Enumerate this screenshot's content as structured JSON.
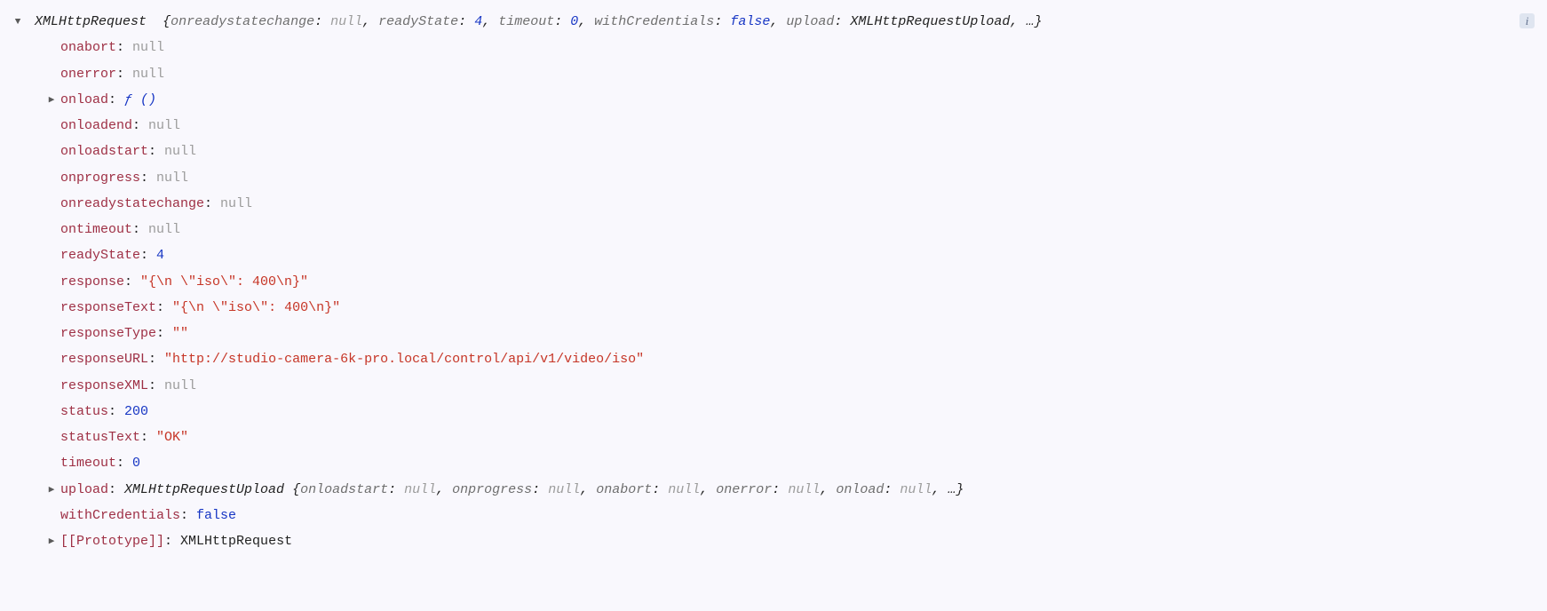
{
  "header": {
    "objectName": "XMLHttpRequest",
    "previewPairs": [
      {
        "key": "onreadystatechange",
        "value": "null",
        "vclass": "prev-null"
      },
      {
        "key": "readyState",
        "value": "4",
        "vclass": "prev-num"
      },
      {
        "key": "timeout",
        "value": "0",
        "vclass": "prev-num"
      },
      {
        "key": "withCredentials",
        "value": "false",
        "vclass": "prev-bool"
      },
      {
        "key": "upload",
        "value": "XMLHttpRequestUpload",
        "vclass": "prev-obj"
      }
    ],
    "ellipsis": "…",
    "infoBadge": "i"
  },
  "props": {
    "onabort": {
      "key": "onabort",
      "value": "null",
      "vclass": "val-null"
    },
    "onerror": {
      "key": "onerror",
      "value": "null",
      "vclass": "val-null"
    },
    "onload": {
      "key": "onload",
      "value": "ƒ ()",
      "vclass": "val-func"
    },
    "onloadend": {
      "key": "onloadend",
      "value": "null",
      "vclass": "val-null"
    },
    "onloadstart": {
      "key": "onloadstart",
      "value": "null",
      "vclass": "val-null"
    },
    "onprogress": {
      "key": "onprogress",
      "value": "null",
      "vclass": "val-null"
    },
    "onreadystatechange": {
      "key": "onreadystatechange",
      "value": "null",
      "vclass": "val-null"
    },
    "ontimeout": {
      "key": "ontimeout",
      "value": "null",
      "vclass": "val-null"
    },
    "readyState": {
      "key": "readyState",
      "value": "4",
      "vclass": "val-num"
    },
    "response": {
      "key": "response",
      "value": "\"{\\n    \\\"iso\\\": 400\\n}\"",
      "vclass": "val-str"
    },
    "responseText": {
      "key": "responseText",
      "value": "\"{\\n    \\\"iso\\\": 400\\n}\"",
      "vclass": "val-str"
    },
    "responseType": {
      "key": "responseType",
      "value": "\"\"",
      "vclass": "val-str"
    },
    "responseURL": {
      "key": "responseURL",
      "value": "\"http://studio-camera-6k-pro.local/control/api/v1/video/iso\"",
      "vclass": "val-str"
    },
    "responseXML": {
      "key": "responseXML",
      "value": "null",
      "vclass": "val-null"
    },
    "status": {
      "key": "status",
      "value": "200",
      "vclass": "val-num"
    },
    "statusText": {
      "key": "statusText",
      "value": "\"OK\"",
      "vclass": "val-str"
    },
    "timeout": {
      "key": "timeout",
      "value": "0",
      "vclass": "val-num"
    },
    "withCredentials": {
      "key": "withCredentials",
      "value": "false",
      "vclass": "val-bool"
    },
    "prototype": {
      "key": "[[Prototype]]",
      "value": "XMLHttpRequest",
      "vclass": "val-obj"
    }
  },
  "upload": {
    "key": "upload",
    "objectName": "XMLHttpRequestUpload",
    "previewPairs": [
      {
        "key": "onloadstart",
        "value": "null",
        "vclass": "prev-null"
      },
      {
        "key": "onprogress",
        "value": "null",
        "vclass": "prev-null"
      },
      {
        "key": "onabort",
        "value": "null",
        "vclass": "prev-null"
      },
      {
        "key": "onerror",
        "value": "null",
        "vclass": "prev-null"
      },
      {
        "key": "onload",
        "value": "null",
        "vclass": "prev-null"
      }
    ],
    "ellipsis": "…"
  }
}
